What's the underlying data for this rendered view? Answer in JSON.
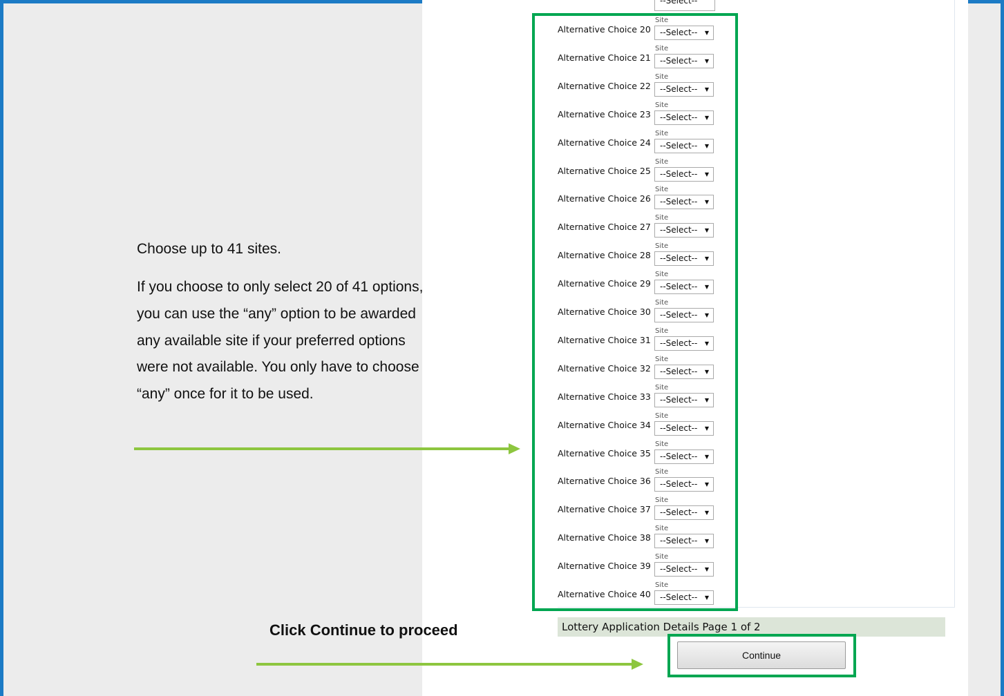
{
  "form": {
    "top_select_value": "--Select--",
    "site_label": "Site",
    "select_placeholder": "--Select--",
    "choices": [
      {
        "label": "Alternative Choice 20",
        "site_label": "Site",
        "value": "--Select--"
      },
      {
        "label": "Alternative Choice 21",
        "site_label": "Site",
        "value": "--Select--"
      },
      {
        "label": "Alternative Choice 22",
        "site_label": "Site",
        "value": "--Select--"
      },
      {
        "label": "Alternative Choice 23",
        "site_label": "Site",
        "value": "--Select--"
      },
      {
        "label": "Alternative Choice 24",
        "site_label": "Site",
        "value": "--Select--"
      },
      {
        "label": "Alternative Choice 25",
        "site_label": "Site",
        "value": "--Select--"
      },
      {
        "label": "Alternative Choice 26",
        "site_label": "Site",
        "value": "--Select--"
      },
      {
        "label": "Alternative Choice 27",
        "site_label": "Site",
        "value": "--Select--"
      },
      {
        "label": "Alternative Choice 28",
        "site_label": "Site",
        "value": "--Select--"
      },
      {
        "label": "Alternative Choice 29",
        "site_label": "Site",
        "value": "--Select--"
      },
      {
        "label": "Alternative Choice 30",
        "site_label": "Site",
        "value": "--Select--"
      },
      {
        "label": "Alternative Choice 31",
        "site_label": "Site",
        "value": "--Select--"
      },
      {
        "label": "Alternative Choice 32",
        "site_label": "Site",
        "value": "--Select--"
      },
      {
        "label": "Alternative Choice 33",
        "site_label": "Site",
        "value": "--Select--"
      },
      {
        "label": "Alternative Choice 34",
        "site_label": "Site",
        "value": "--Select--"
      },
      {
        "label": "Alternative Choice 35",
        "site_label": "Site",
        "value": "--Select--"
      },
      {
        "label": "Alternative Choice 36",
        "site_label": "Site",
        "value": "--Select--"
      },
      {
        "label": "Alternative Choice 37",
        "site_label": "Site",
        "value": "--Select--"
      },
      {
        "label": "Alternative Choice 38",
        "site_label": "Site",
        "value": "--Select--"
      },
      {
        "label": "Alternative Choice 39",
        "site_label": "Site",
        "value": "--Select--"
      },
      {
        "label": "Alternative Choice 40",
        "site_label": "Site",
        "value": "--Select--"
      }
    ],
    "page_indicator": "Lottery Application Details Page 1 of 2",
    "continue_label": "Continue"
  },
  "instructions": {
    "line1": "Choose up to 41 sites.",
    "paragraph": [
      "If you choose to only select 20 of 41 options,",
      "you can use the “any” option to be awarded",
      "any available site if your preferred options",
      "were not available. You only have to choose",
      "“any” once for it to be used."
    ],
    "click_continue": "Click Continue to proceed"
  },
  "colors": {
    "frame_border": "#1c7bc5",
    "highlight_box": "#00a651",
    "arrow": "#8dc63f",
    "footer_bar": "#dce5d8"
  }
}
